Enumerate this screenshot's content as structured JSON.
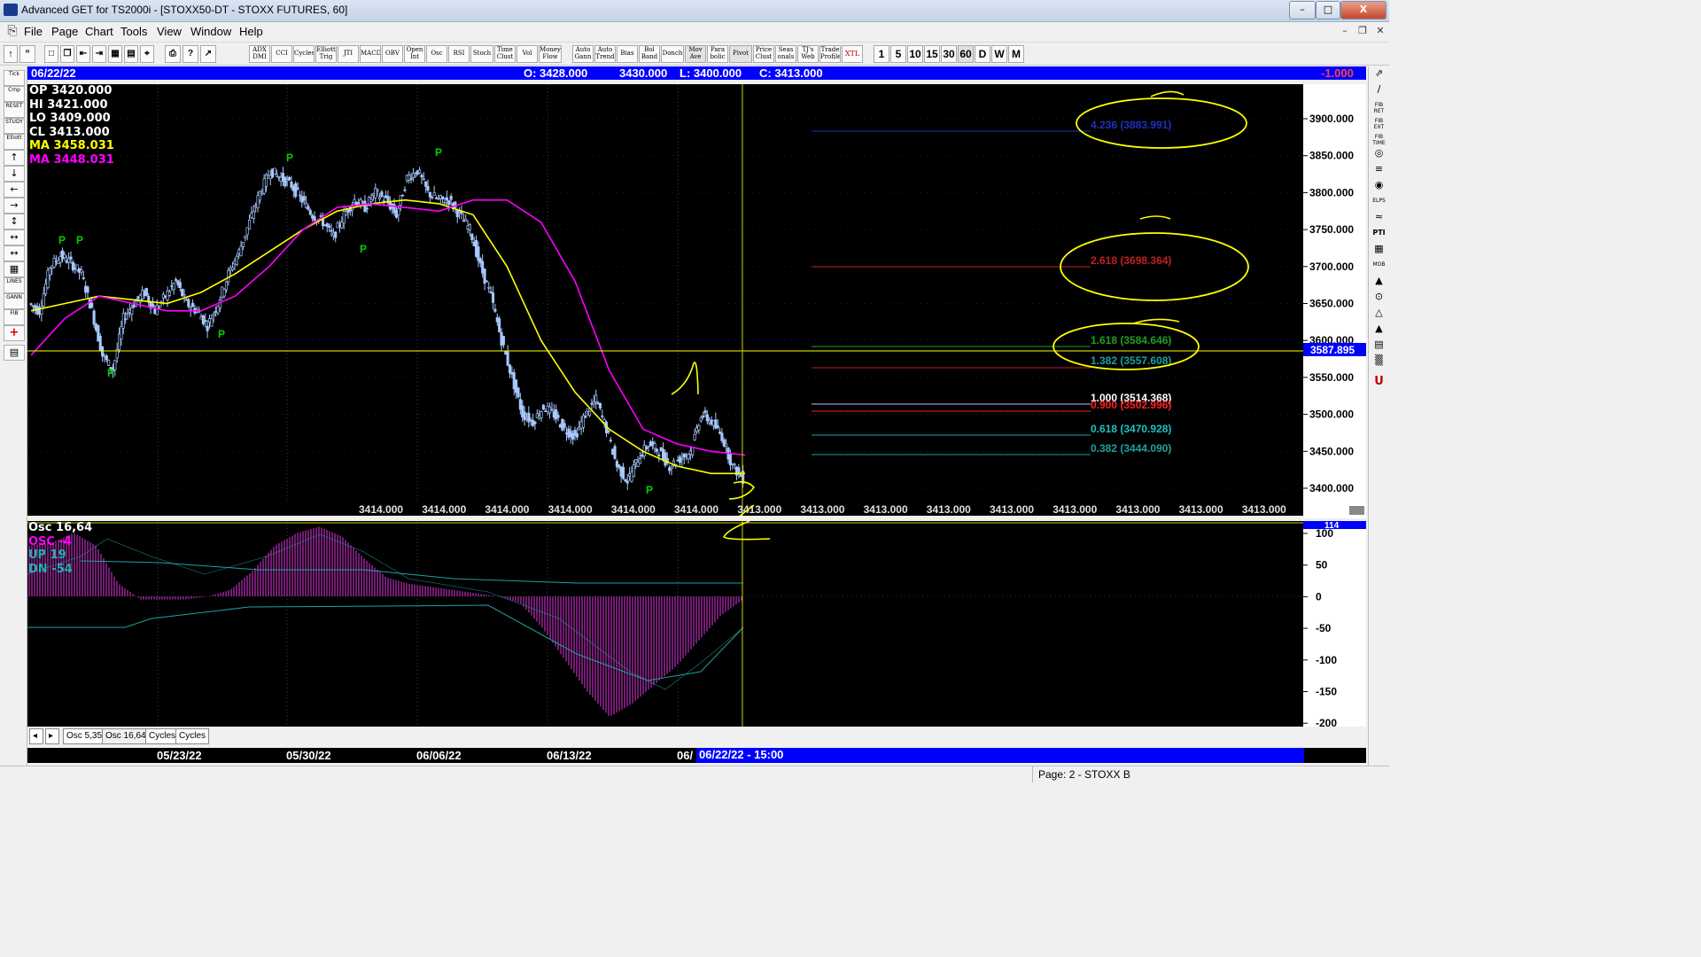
{
  "window": {
    "title": "Advanced GET for TS2000i - [STOXX50-DT - STOXX FUTURES, 60]",
    "minimize": "–",
    "maximize": "□",
    "close": "X"
  },
  "menu": [
    "File",
    "Page",
    "Chart",
    "Tools",
    "View",
    "Window",
    "Help"
  ],
  "toolbar": {
    "studies": [
      "ADX DMI",
      "CCI",
      "Cycles",
      "Elliott Trig",
      "JTI",
      "MACD",
      "OBV",
      "Open Int",
      "Osc",
      "RSI",
      "Stoch",
      "Time Clust",
      "Vol",
      "Money Flow",
      "Auto Gann",
      "Auto Trend",
      "Bias",
      "Bol Band",
      "Donch",
      "Mov Ave",
      "Para bolic",
      "Pivot",
      "Price Clust",
      "Seas onals",
      "TJ's Web",
      "Trade Profile",
      "XTL"
    ],
    "periods": [
      "1",
      "5",
      "10",
      "15",
      "30",
      "60",
      "D",
      "W",
      "M"
    ]
  },
  "left_tools": [
    "Tick",
    "Cmp",
    "RESET",
    "STUDY",
    "Elliott",
    "↑",
    "↓",
    "←",
    "→",
    "↕",
    "↔",
    "↔",
    "▦",
    "LINES",
    "GANN",
    "FIB",
    "+",
    "▤"
  ],
  "right_tools": [
    "⇗",
    "∕",
    "FIB RET",
    "FIB EXT",
    "FIB TIME",
    "◎",
    "≡",
    "◉",
    "ELPS",
    "≈",
    "PTI",
    "▦",
    "MOB",
    "▲",
    "⊙",
    "△",
    "▲",
    "▤",
    "▒",
    "U"
  ],
  "header": {
    "date": "06/22/22",
    "open": "O: 3428.000",
    "high": "3430.000",
    "low": "L: 3400.000",
    "close": "C: 3413.000",
    "change": "-1.000"
  },
  "info_box": [
    {
      "label": "OP",
      "value": "3420.000",
      "color": "#ffffff"
    },
    {
      "label": "HI",
      "value": "3421.000",
      "color": "#ffffff"
    },
    {
      "label": "LO",
      "value": "3409.000",
      "color": "#ffffff"
    },
    {
      "label": "CL",
      "value": "3413.000",
      "color": "#ffffff"
    },
    {
      "label": "MA",
      "value": "3458.031",
      "color": "#ffff00"
    },
    {
      "label": "MA",
      "value": "3448.031",
      "color": "#ff00ff"
    }
  ],
  "price_axis": {
    "ticks": [
      "3900.000",
      "3850.000",
      "3800.000",
      "3750.000",
      "3700.000",
      "3650.000",
      "3600.000",
      "3550.000",
      "3500.000",
      "3450.000",
      "3400.000"
    ],
    "current_marker": "3587.895"
  },
  "bottom_price_labels": [
    "3414.000",
    "3414.000",
    "3414.000",
    "3414.000",
    "3414.000",
    "3414.000",
    "3413.000",
    "3413.000",
    "3413.000",
    "3413.000",
    "3413.000",
    "3413.000",
    "3413.000",
    "3413.000",
    "3413.000"
  ],
  "fib_levels": [
    {
      "label": "4.236 (3883.991)",
      "color": "#2030c0"
    },
    {
      "label": "2.618 (3698.364)",
      "color": "#c02020"
    },
    {
      "label": "1.618 (3584.646)",
      "color": "#20a020"
    },
    {
      "label": "1.382 (3557.608)",
      "color": "#20a0a0"
    },
    {
      "label": "1.000 (3514.368)",
      "color": "#ffffff"
    },
    {
      "label": "0.900 (3502.996)",
      "color": "#ff2020"
    },
    {
      "label": "0.618 (3470.928)",
      "color": "#20c0c0"
    },
    {
      "label": "0.382 (3444.090)",
      "color": "#20a0a0"
    }
  ],
  "pivot_marker": "P",
  "osc": {
    "header": "Osc 16,64",
    "osc": "OSC -4",
    "up": "UP  19",
    "dn": "DN  -54",
    "ticks": [
      "100",
      "50",
      "0",
      "-50",
      "-100",
      "-150",
      "-200"
    ],
    "current": "114"
  },
  "tabs": [
    "Osc 5,35",
    "Osc 16,64",
    "Cycles",
    "Cycles"
  ],
  "date_axis": {
    "dates": [
      "05/23/22",
      "05/30/22",
      "06/06/22",
      "06/13/22",
      "06/"
    ],
    "cursor": "06/22/22 - 15:00"
  },
  "status": "Page: 2 - STOXX B",
  "chart_data": {
    "type": "candlestick",
    "interval": "60 minute",
    "ylim": [
      3380,
      3920
    ],
    "close_series_approx": [
      3650,
      3640,
      3700,
      3715,
      3705,
      3690,
      3640,
      3580,
      3560,
      3630,
      3650,
      3665,
      3640,
      3660,
      3680,
      3650,
      3640,
      3620,
      3650,
      3690,
      3720,
      3760,
      3800,
      3830,
      3820,
      3810,
      3790,
      3770,
      3760,
      3740,
      3770,
      3790,
      3780,
      3800,
      3790,
      3770,
      3820,
      3830,
      3800,
      3790,
      3790,
      3770,
      3750,
      3700,
      3660,
      3600,
      3550,
      3500,
      3490,
      3510,
      3500,
      3480,
      3470,
      3500,
      3520,
      3480,
      3430,
      3410,
      3440,
      3460,
      3450,
      3430,
      3440,
      3450,
      3500,
      3490,
      3470,
      3430,
      3413
    ],
    "ma_yellow_approx": [
      3640,
      3650,
      3660,
      3655,
      3650,
      3665,
      3690,
      3720,
      3750,
      3775,
      3785,
      3790,
      3785,
      3770,
      3700,
      3600,
      3530,
      3480,
      3450,
      3430,
      3420,
      3420
    ],
    "ma_magenta_approx": [
      3580,
      3630,
      3660,
      3650,
      3640,
      3640,
      3660,
      3700,
      3750,
      3780,
      3785,
      3780,
      3775,
      3790,
      3790,
      3760,
      3680,
      3560,
      3480,
      3460,
      3450,
      3445
    ],
    "osc_histogram_approx": [
      80,
      85,
      100,
      80,
      20,
      -5,
      -5,
      -5,
      0,
      10,
      40,
      80,
      100,
      110,
      95,
      60,
      30,
      20,
      15,
      10,
      5,
      0,
      -10,
      -50,
      -100,
      -150,
      -190,
      -170,
      -140,
      -110,
      -70,
      -30,
      -5
    ]
  }
}
